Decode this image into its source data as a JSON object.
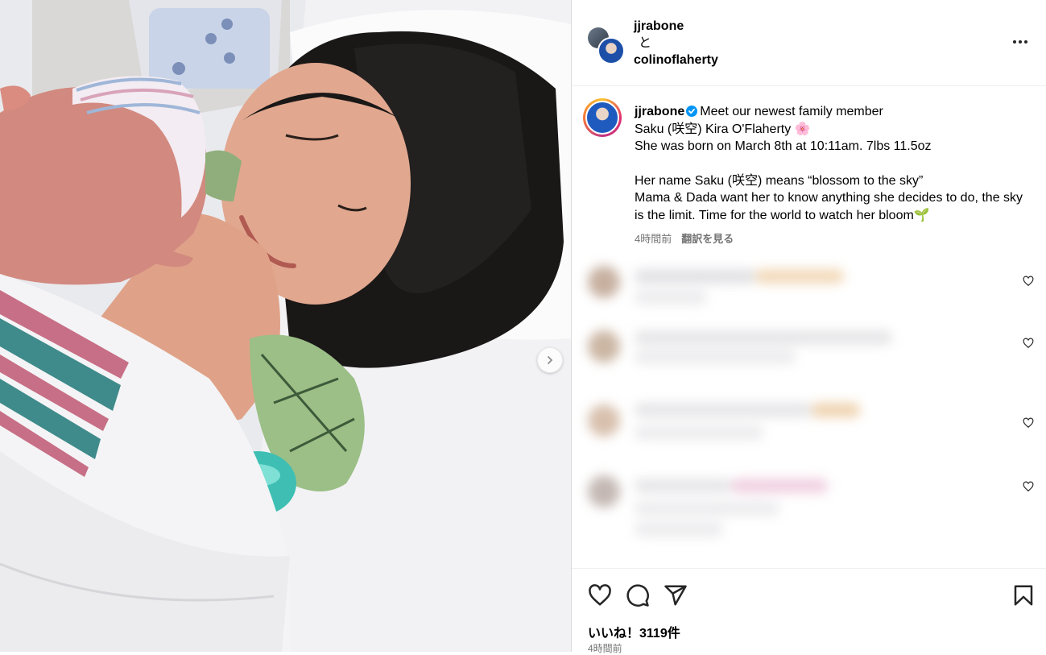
{
  "post": {
    "media_next_label": "›",
    "header": {
      "user1": "jjrabone",
      "connector": "と",
      "user2": "colinoflaherty"
    },
    "caption": {
      "username": "jjrabone",
      "lines": [
        "Meet our newest family member",
        "Saku (咲空) Kira O'Flaherty 🌸",
        "She was born on March 8th at 10:11am. 7lbs 11.5oz",
        "",
        "Her name Saku (咲空) means “blossom to the sky”",
        "Mama & Dada want her to know anything she decides to do, the sky is the limit. Time for the world to watch her bloom🌱"
      ],
      "time": "4時間前",
      "translate": "翻訳を見る"
    },
    "likes": "いいね！3119件",
    "time": "4時間前",
    "icons": [
      "heart-icon",
      "comment-icon",
      "share-icon",
      "bookmark-icon",
      "more-icon",
      "verified-icon",
      "chevron-right-icon"
    ]
  }
}
